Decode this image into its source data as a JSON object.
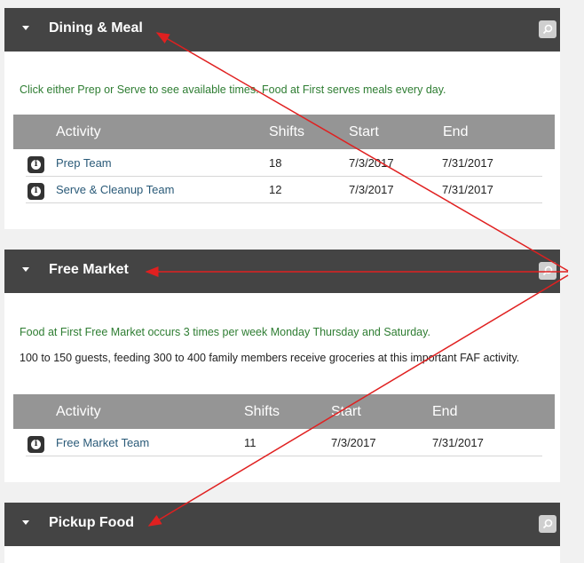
{
  "sections": [
    {
      "title": "Dining & Meal",
      "notes": [
        "Click either Prep or Serve to see available times. Food at First serves meals every day."
      ],
      "columns": {
        "activity": "Activity",
        "shifts": "Shifts",
        "start": "Start",
        "end": "End"
      },
      "rows": [
        {
          "activity": "Prep Team",
          "shifts": "18",
          "start": "7/3/2017",
          "end": "7/31/2017"
        },
        {
          "activity": "Serve & Cleanup Team",
          "shifts": "12",
          "start": "7/3/2017",
          "end": "7/31/2017"
        }
      ]
    },
    {
      "title": "Free Market",
      "notes": [
        "Food at First Free Market occurs 3 times per week Monday Thursday and Saturday.",
        "100 to 150 guests, feeding 300 to 400 family members receive groceries at this important FAF activity."
      ],
      "columns": {
        "activity": "Activity",
        "shifts": "Shifts",
        "start": "Start",
        "end": "End"
      },
      "rows": [
        {
          "activity": "Free Market Team",
          "shifts": "11",
          "start": "7/3/2017",
          "end": "7/31/2017"
        }
      ]
    },
    {
      "title": "Pickup Food"
    }
  ],
  "icons": {
    "collapse": "caret-down-icon",
    "zoom": "magnifier-icon",
    "info": "info-icon"
  },
  "colors": {
    "header_bg": "#444444",
    "table_header_bg": "#959595",
    "note_green": "#2e7d32",
    "link": "#2a5a78",
    "annotation_arrow": "#e02020"
  }
}
